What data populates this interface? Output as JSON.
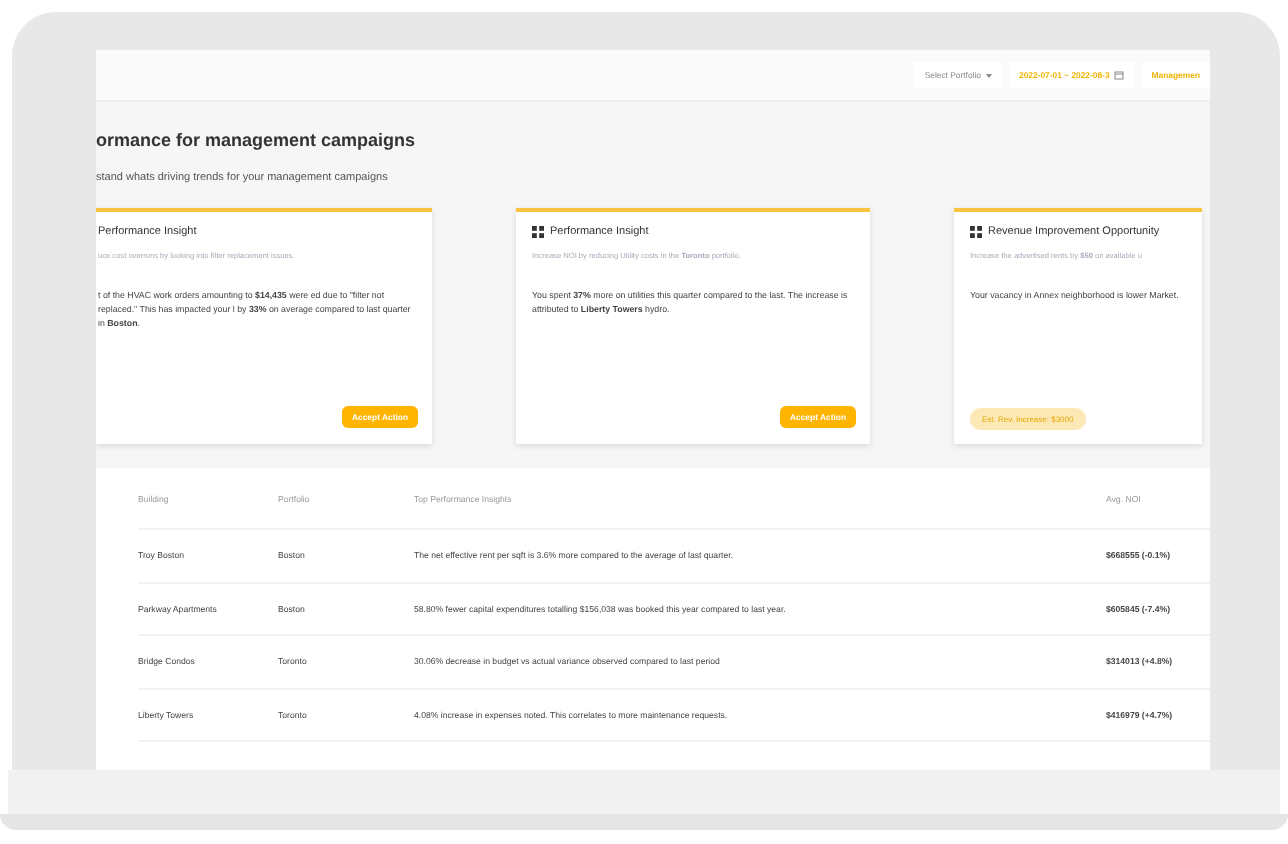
{
  "toolbar": {
    "portfolio_select": "Select Portfolio",
    "date_range": "2022-07-01 ~ 2022-08-3",
    "view_button": "Managemen"
  },
  "page": {
    "title": "ormance for management campaigns",
    "subtitle": "stand whats driving trends for your management campaigns"
  },
  "cards": [
    {
      "title": "Performance Insight",
      "icon": false,
      "subtitle": "uce cost overruns by looking into filter replacement issues.",
      "body": "t of the HVAC work orders amounting to **$14,435** were ed due to \"filter not replaced.\" This has impacted your l by **33%** on average compared to last quarter in **Boston**.",
      "action": {
        "kind": "button",
        "label": "Accept Action"
      }
    },
    {
      "title": "Performance Insight",
      "icon": true,
      "subtitle": "Increase NOI by reducing Utility costs in the **Toronto** portfolio.",
      "body": "You spent **37%** more on utilities this quarter compared to the last. The increase is attributed to **Liberty Towers** hydro.",
      "action": {
        "kind": "button",
        "label": "Accept Action"
      }
    },
    {
      "title": "Revenue Improvement Opportunity",
      "icon": true,
      "subtitle": "Increase the advertised rents by **$50** on available u",
      "body": "Your vacancy in Annex neighborhood is lower Market.",
      "action": {
        "kind": "badge",
        "label": "Est. Rev. Increase: $3000"
      }
    }
  ],
  "table": {
    "columns": [
      "Building",
      "Portfolio",
      "Top Performance Insights",
      "Avg. NOI"
    ],
    "rows": [
      [
        "Troy Boston",
        "Boston",
        "The net effective rent per sqft is 3.6% more compared to the average of last quarter.",
        "$668555 (-0.1%)"
      ],
      [
        "Parkway Apartments",
        "Boston",
        "58.80% fewer capital expenditures totalling $156,038 was booked this year compared to last year.",
        "$605845 (-7.4%)"
      ],
      [
        "Bridge Condos",
        "Toronto",
        "30.06% decrease in budget vs actual variance observed compared to last period",
        "$314013 (+4.8%)"
      ],
      [
        "Liberty Towers",
        "Toronto",
        "4.08% increase in expenses noted. This correlates to more maintenance requests.",
        "$416979 (+4.7%)"
      ]
    ]
  }
}
